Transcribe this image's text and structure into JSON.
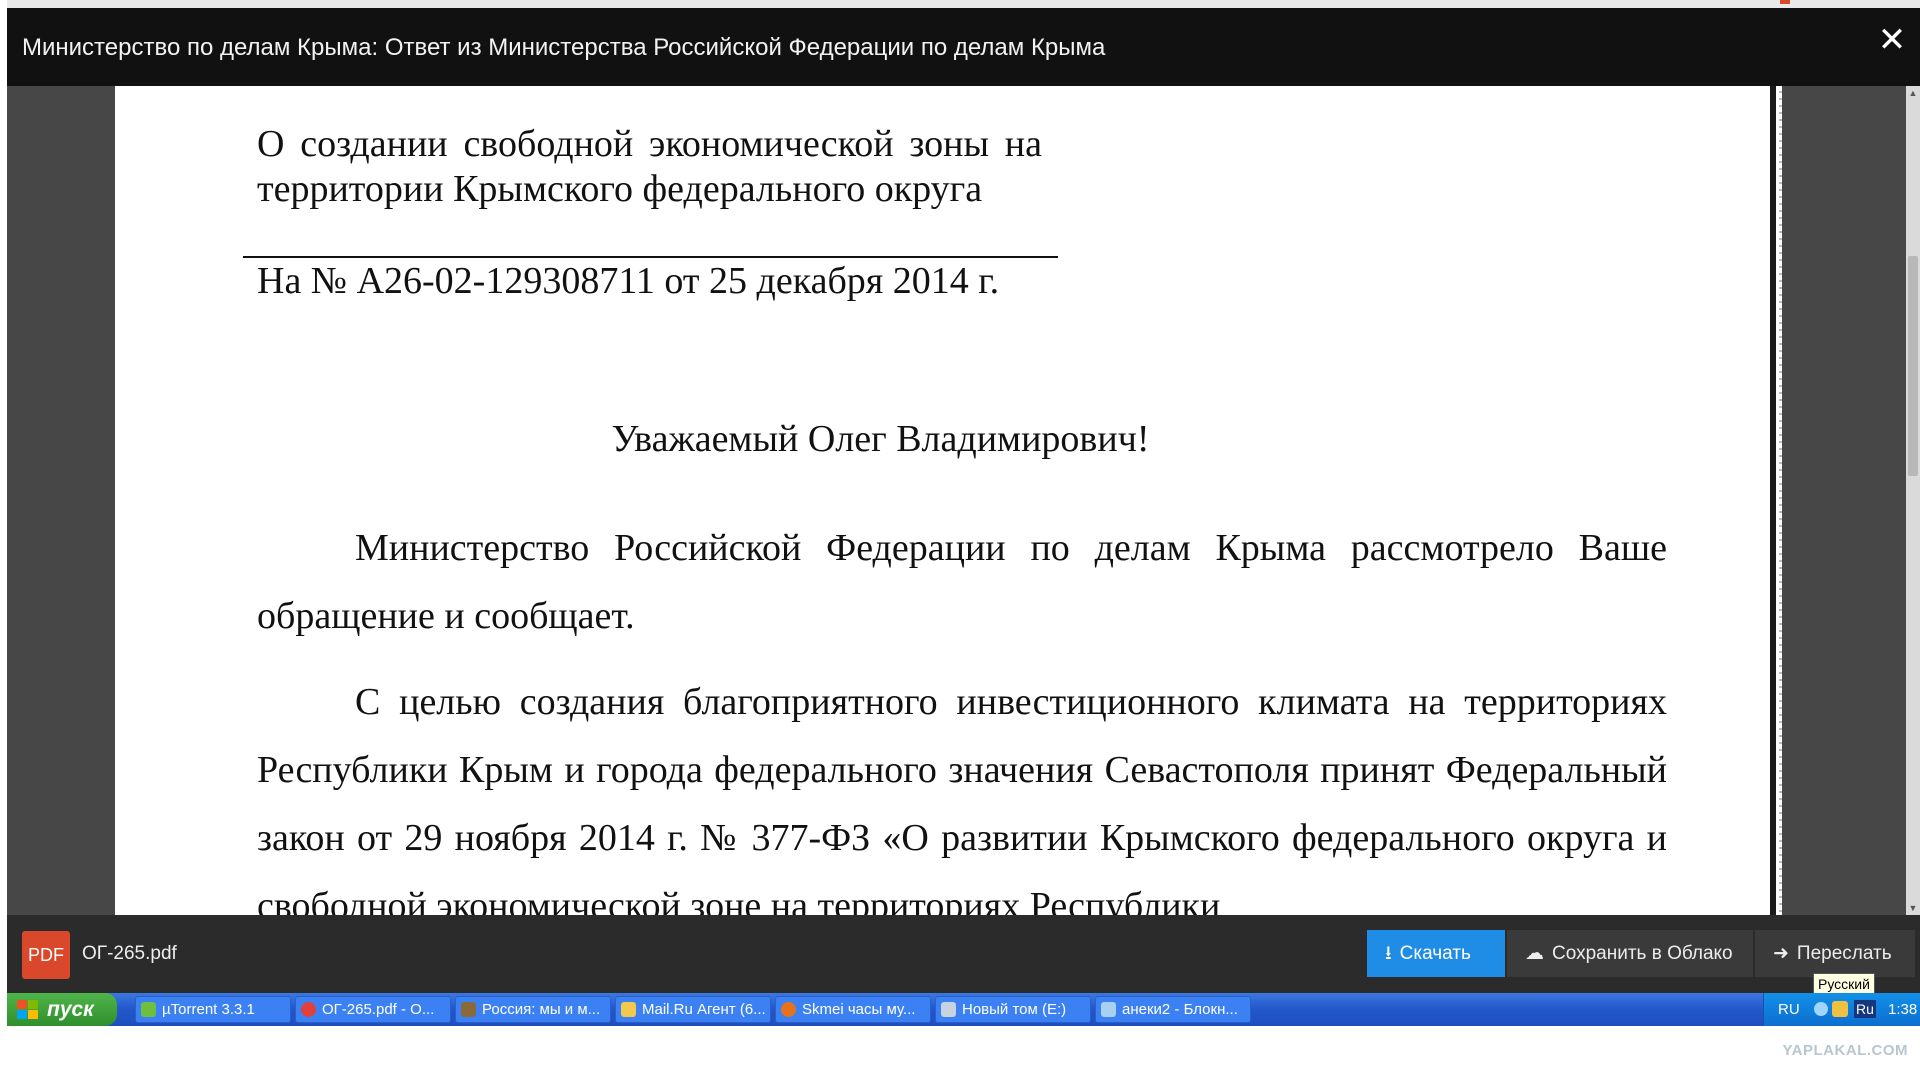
{
  "viewer": {
    "title": "Министерство по делам Крыма: Ответ из Министерства Российской Федерации по делам Крыма",
    "close_label": "✕"
  },
  "document": {
    "subject": "О создании свободной экономической зоны на территории Крымского федерального округа",
    "reference": "На № А26-02-129308711 от 25 декабря 2014 г.",
    "salutation": "Уважаемый Олег Владимирович!",
    "paragraph1": "Министерство Российской Федерации по делам Крыма рассмотрело Ваше обращение и сообщает.",
    "paragraph2": "С целью создания благоприятного инвестиционного климата на территориях Республики Крым и города федерального значения Севастополя принят Федеральный закон от 29 ноября 2014 г. № 377-ФЗ «О развитии Крымского федерального округа и свободной экономической зоне на территориях Республики"
  },
  "footer": {
    "file_icon_label": "PDF",
    "file_name": "ОГ-265.pdf",
    "download_label": "Скачать",
    "cloud_label": "Сохранить в Облако",
    "forward_label": "Переслать",
    "tooltip": "Русский"
  },
  "taskbar": {
    "start_label": "пуск",
    "tasks": [
      "µTorrent 3.3.1",
      "ОГ-265.pdf - О...",
      "Россия: мы и м...",
      "Mail.Ru Агент (6...",
      "Skmei часы му...",
      "Новый том (E:)",
      "анеки2 - Блокн..."
    ],
    "tray_lang": "RU",
    "tray_layout": "Ru",
    "clock": "1:38"
  },
  "watermark": "YAPLAKAL.COM",
  "colors": {
    "header_bg": "#111111",
    "viewer_bg": "#474747",
    "footer_bg": "#2b2b2b",
    "accent_blue": "#1f8ce6",
    "pdf_red": "#d9482b",
    "taskbar_blue": "#2257c9",
    "start_green": "#3a9f36"
  },
  "icons": {
    "close": "close-icon",
    "file": "pdf-file-icon",
    "download": "download-icon",
    "cloud": "cloud-save-icon",
    "forward": "forward-arrow-icon",
    "start": "windows-flag-icon"
  }
}
